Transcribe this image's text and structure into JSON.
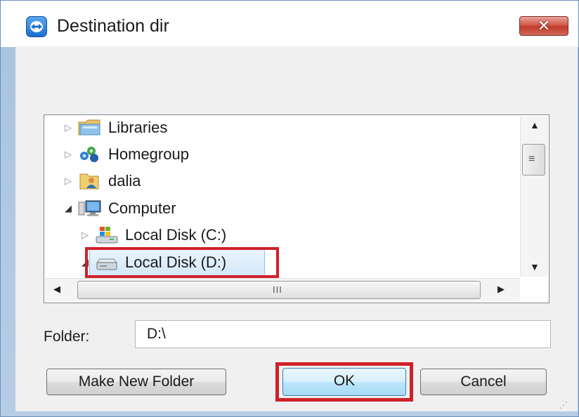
{
  "window": {
    "title": "Destination dir",
    "close_label": "✕"
  },
  "tree": {
    "items": [
      {
        "label": "Libraries",
        "icon": "libraries-icon",
        "expander": "▷"
      },
      {
        "label": "Homegroup",
        "icon": "homegroup-icon",
        "expander": "▷"
      },
      {
        "label": "dalia",
        "icon": "user-folder-icon",
        "expander": "▷"
      },
      {
        "label": "Computer",
        "icon": "computer-icon",
        "expander": "◢"
      },
      {
        "label": "Local Disk (C:)",
        "icon": "windows-drive-icon",
        "expander": "▷"
      },
      {
        "label": "Local Disk (D:)",
        "icon": "drive-icon",
        "expander": "◢",
        "selected": true
      }
    ],
    "vscroll_grip": "≡",
    "hscroll_grip": "III",
    "arrows": {
      "up": "▲",
      "down": "▼",
      "left": "◀",
      "right": "▶"
    }
  },
  "folder": {
    "label": "Folder:",
    "value": "D:\\"
  },
  "buttons": {
    "make_new_folder": "Make New Folder",
    "ok": "OK",
    "cancel": "Cancel"
  },
  "colors": {
    "highlight": "#d0202a",
    "selection": "#d3e8fb"
  }
}
